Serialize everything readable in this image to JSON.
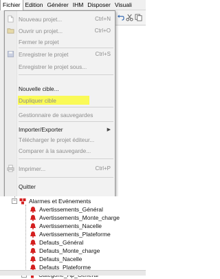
{
  "menubar": {
    "items": [
      "Fichier",
      "Edition",
      "Générer",
      "IHM",
      "Disposer",
      "Visuali"
    ]
  },
  "file_menu": {
    "items": [
      {
        "label": "Nouveau projet...",
        "shortcut": "Ctrl+N",
        "enabled": false,
        "icon": "new-document-icon"
      },
      {
        "label": "Ouvrir un projet...",
        "shortcut": "Ctrl+O",
        "enabled": false,
        "icon": "open-folder-icon"
      },
      {
        "label": "Fermer le projet",
        "shortcut": "",
        "enabled": false,
        "icon": ""
      },
      {
        "label": "Enregistrer le projet",
        "shortcut": "Ctrl+S",
        "enabled": false,
        "icon": "save-icon"
      },
      {
        "label": "Enregistrer le projet sous...",
        "shortcut": "",
        "enabled": false,
        "icon": ""
      },
      {
        "label": "Nouvelle cible...",
        "shortcut": "",
        "enabled": true,
        "icon": ""
      },
      {
        "label": "Dupliquer cible",
        "shortcut": "",
        "enabled": false,
        "icon": ""
      },
      {
        "label": "Gestionnaire de sauvegardes",
        "shortcut": "",
        "enabled": false,
        "icon": ""
      },
      {
        "label": "Importer/Exporter",
        "shortcut": "",
        "enabled": true,
        "icon": "",
        "submenu": true
      },
      {
        "label": "Télécharger le projet éditeur...",
        "shortcut": "",
        "enabled": false,
        "icon": ""
      },
      {
        "label": "Comparer à la sauvegarde...",
        "shortcut": "",
        "enabled": false,
        "icon": ""
      },
      {
        "label": "Imprimer...",
        "shortcut": "Ctrl+P",
        "enabled": false,
        "icon": "printer-icon"
      },
      {
        "label": "Quitter",
        "shortcut": "",
        "enabled": true,
        "icon": ""
      }
    ]
  },
  "tree": {
    "group": "Alarmes et Evénements",
    "items": [
      "Avertissements_Général",
      "Avertissements_Monte_charge",
      "Avertissements_Nacelle",
      "Avertissements_Plateforme",
      "Defauts_Général",
      "Defauts_Monte_charge",
      "Defauts_Nacelle",
      "Defauts_Plateforme"
    ],
    "last_item": "Categorie_Ap_General"
  },
  "colors": {
    "highlight": "#fbfb3c",
    "bell_red": "#d42020",
    "disabled_text": "#8d8d8d"
  }
}
